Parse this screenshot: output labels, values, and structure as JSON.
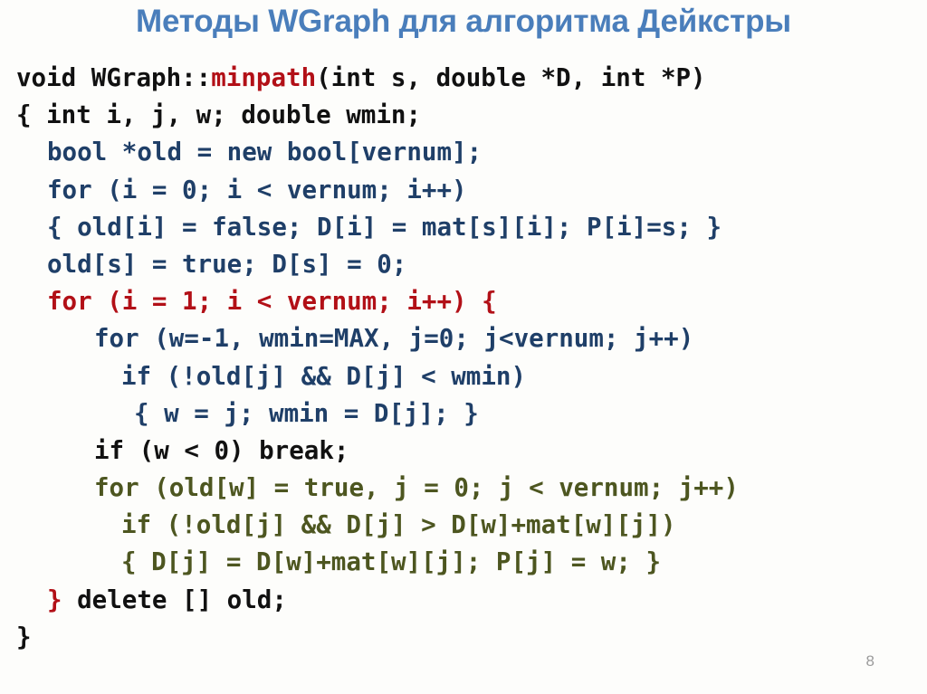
{
  "slide": {
    "title": "Методы WGraph для алгоритма Дейкстры",
    "page_number": "8",
    "background_color": "#fdfdfb",
    "title_color": "#4a7ebb",
    "page_number_color": "#9b9b9b"
  },
  "code": {
    "language": "C++",
    "colors": {
      "black": "#111111",
      "blue": "#1f3f68",
      "red": "#b21017",
      "olive": "#4d5620"
    },
    "lines": [
      {
        "indent": 18,
        "segments": [
          {
            "text": "void WGraph::",
            "color": "black",
            "bold": true
          },
          {
            "text": "minpath",
            "color": "red",
            "bold": true
          },
          {
            "text": "(int s, double *D, int *P)",
            "color": "black",
            "bold": true
          }
        ]
      },
      {
        "indent": 18,
        "segments": [
          {
            "text": "{ int i, j, w; double wmin;",
            "color": "black",
            "bold": true
          }
        ]
      },
      {
        "indent": 52,
        "segments": [
          {
            "text": "bool *old = new bool[vernum];",
            "color": "blue",
            "bold": true
          }
        ]
      },
      {
        "indent": 52,
        "segments": [
          {
            "text": "for (i = 0; i < vernum; i++)",
            "color": "blue",
            "bold": true
          }
        ]
      },
      {
        "indent": 52,
        "segments": [
          {
            "text": "{ old[i] = false; D[i] = mat[s][i]; P[i]=s; }",
            "color": "blue",
            "bold": true
          }
        ]
      },
      {
        "indent": 52,
        "segments": [
          {
            "text": "old[s] = true; D[s] = 0;",
            "color": "blue",
            "bold": true
          }
        ]
      },
      {
        "indent": 52,
        "segments": [
          {
            "text": "for (i = 1; i < vernum; i++) {",
            "color": "red",
            "bold": true
          }
        ]
      },
      {
        "indent": 104,
        "segments": [
          {
            "text": "for (w=-1, wmin=MAX, j=0; j<vernum; j++)",
            "color": "blue",
            "bold": true
          }
        ]
      },
      {
        "indent": 134,
        "segments": [
          {
            "text": "if (!old[j] && D[j] < wmin)",
            "color": "blue",
            "bold": true
          }
        ]
      },
      {
        "indent": 148,
        "segments": [
          {
            "text": "{ w = j; wmin = D[j]; }",
            "color": "blue",
            "bold": true
          }
        ]
      },
      {
        "indent": 104,
        "segments": [
          {
            "text": "if (w < 0) break;",
            "color": "black",
            "bold": true
          }
        ]
      },
      {
        "indent": 104,
        "segments": [
          {
            "text": "for (old[w] = true, j = 0; j < vernum; j++)",
            "color": "olive",
            "bold": true
          }
        ]
      },
      {
        "indent": 134,
        "segments": [
          {
            "text": "if (!old[j] && D[j] > D[w]+mat[w][j])",
            "color": "olive",
            "bold": true
          }
        ]
      },
      {
        "indent": 134,
        "segments": [
          {
            "text": "{ D[j] = D[w]+mat[w][j]; P[j] = w; }",
            "color": "olive",
            "bold": true
          }
        ]
      },
      {
        "indent": 52,
        "segments": [
          {
            "text": "}",
            "color": "red",
            "bold": true
          },
          {
            "text": " delete [] old;",
            "color": "black",
            "bold": true
          }
        ]
      },
      {
        "indent": 18,
        "segments": [
          {
            "text": "}",
            "color": "black",
            "bold": true
          }
        ]
      }
    ]
  }
}
